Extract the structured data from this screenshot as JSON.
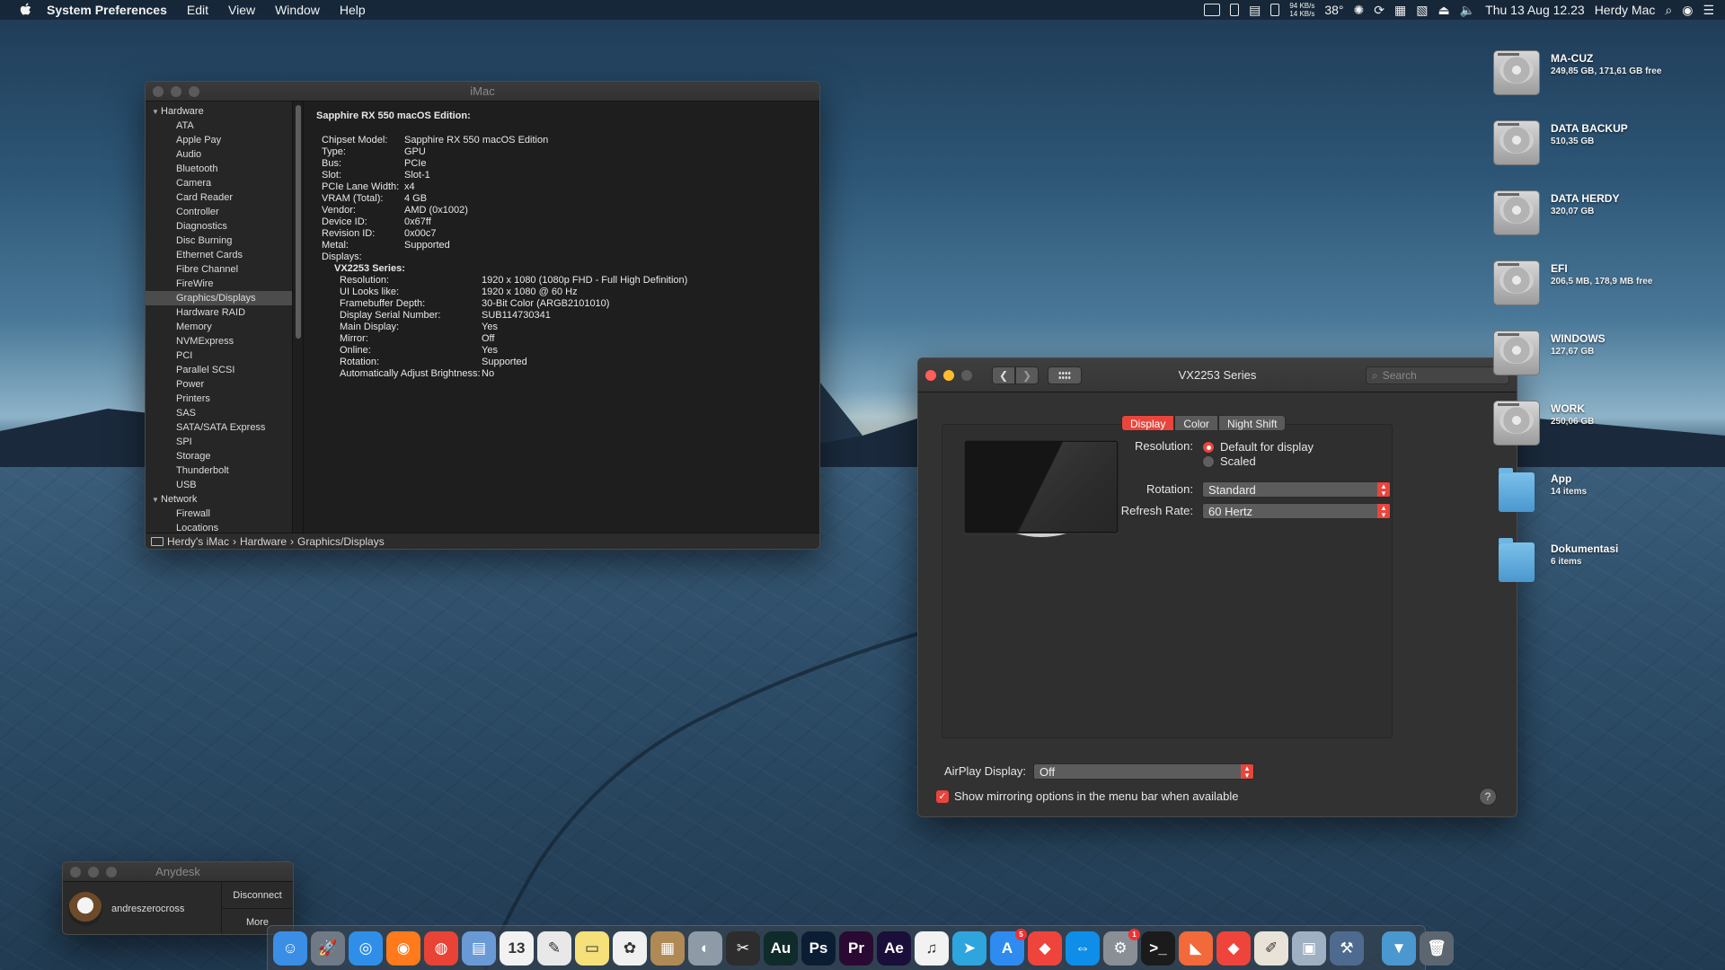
{
  "menubar": {
    "app_name": "System Preferences",
    "menus": [
      "Edit",
      "View",
      "Window",
      "Help"
    ],
    "net_up": "94 KB/s",
    "net_down": "14 KB/s",
    "temperature": "38°",
    "datetime": "Thu 13 Aug  12.23",
    "user": "Herdy Mac"
  },
  "sysinfo": {
    "title": "iMac",
    "sidebar_groups": [
      {
        "label": "Hardware",
        "items": [
          "ATA",
          "Apple Pay",
          "Audio",
          "Bluetooth",
          "Camera",
          "Card Reader",
          "Controller",
          "Diagnostics",
          "Disc Burning",
          "Ethernet Cards",
          "Fibre Channel",
          "FireWire",
          "Graphics/Displays",
          "Hardware RAID",
          "Memory",
          "NVMExpress",
          "PCI",
          "Parallel SCSI",
          "Power",
          "Printers",
          "SAS",
          "SATA/SATA Express",
          "SPI",
          "Storage",
          "Thunderbolt",
          "USB"
        ]
      },
      {
        "label": "Network",
        "items": [
          "Firewall",
          "Locations"
        ]
      }
    ],
    "selected_item": "Graphics/Displays",
    "detail": {
      "heading": "Sapphire RX 550 macOS Edition:",
      "fields": [
        {
          "k": "Chipset Model:",
          "v": "Sapphire RX 550 macOS Edition"
        },
        {
          "k": "Type:",
          "v": "GPU"
        },
        {
          "k": "Bus:",
          "v": "PCIe"
        },
        {
          "k": "Slot:",
          "v": "Slot-1"
        },
        {
          "k": "PCIe Lane Width:",
          "v": "x4"
        },
        {
          "k": "VRAM (Total):",
          "v": "4 GB"
        },
        {
          "k": "Vendor:",
          "v": "AMD (0x1002)"
        },
        {
          "k": "Device ID:",
          "v": "0x67ff"
        },
        {
          "k": "Revision ID:",
          "v": "0x00c7"
        },
        {
          "k": "Metal:",
          "v": "Supported"
        },
        {
          "k": "Displays:",
          "v": ""
        }
      ],
      "display_name": "VX2253 Series:",
      "display_fields": [
        {
          "k": "Resolution:",
          "v": "1920 x 1080 (1080p FHD - Full High Definition)"
        },
        {
          "k": "UI Looks like:",
          "v": "1920 x 1080 @ 60 Hz"
        },
        {
          "k": "Framebuffer Depth:",
          "v": "30-Bit Color (ARGB2101010)"
        },
        {
          "k": "Display Serial Number:",
          "v": "SUB114730341"
        },
        {
          "k": "Main Display:",
          "v": "Yes"
        },
        {
          "k": "Mirror:",
          "v": "Off"
        },
        {
          "k": "Online:",
          "v": "Yes"
        },
        {
          "k": "Rotation:",
          "v": "Supported"
        },
        {
          "k": "Automatically Adjust Brightness:",
          "v": "No"
        }
      ]
    },
    "pathbar": [
      "Herdy's iMac",
      "Hardware",
      "Graphics/Displays"
    ]
  },
  "display_prefs": {
    "title": "VX2253 Series",
    "search_placeholder": "Search",
    "tabs": [
      "Display",
      "Color",
      "Night Shift"
    ],
    "active_tab": "Display",
    "resolution_label": "Resolution:",
    "resolution_options": [
      "Default for display",
      "Scaled"
    ],
    "resolution_selected": "Default for display",
    "rotation_label": "Rotation:",
    "rotation_value": "Standard",
    "refresh_label": "Refresh Rate:",
    "refresh_value": "60 Hertz",
    "airplay_label": "AirPlay Display:",
    "airplay_value": "Off",
    "mirroring_label": "Show mirroring options in the menu bar when available",
    "mirroring_checked": true,
    "help": "?"
  },
  "anydesk": {
    "title": "Anydesk",
    "user": "andreszerocross",
    "disconnect": "Disconnect",
    "more": "More"
  },
  "drives": [
    {
      "name": "MA-CUZ",
      "info": "249,85 GB, 171,61 GB free",
      "kind": "hdd"
    },
    {
      "name": "DATA BACKUP",
      "info": "510,35 GB",
      "kind": "hdd"
    },
    {
      "name": "DATA HERDY",
      "info": "320,07 GB",
      "kind": "hdd"
    },
    {
      "name": "EFI",
      "info": "206,5 MB, 178,9 MB free",
      "kind": "hdd"
    },
    {
      "name": "WINDOWS",
      "info": "127,67 GB",
      "kind": "hdd"
    },
    {
      "name": "WORK",
      "info": "250,06 GB",
      "kind": "hdd"
    },
    {
      "name": "App",
      "info": "14 items",
      "kind": "folder"
    },
    {
      "name": "Dokumentasi",
      "info": "6 items",
      "kind": "folder"
    }
  ],
  "dock": {
    "items": [
      {
        "name": "finder",
        "glyph": "☺",
        "color": "#3a8ee6"
      },
      {
        "name": "launchpad",
        "glyph": "🚀",
        "color": "#6f7a86"
      },
      {
        "name": "safari",
        "glyph": "◎",
        "color": "#2f8fe8"
      },
      {
        "name": "firefox",
        "glyph": "◉",
        "color": "#ff7a1a"
      },
      {
        "name": "chrome",
        "glyph": "◍",
        "color": "#e94335"
      },
      {
        "name": "preview",
        "glyph": "▤",
        "color": "#6a9ad6"
      },
      {
        "name": "calendar",
        "glyph": "13",
        "color": "#f2f2f2"
      },
      {
        "name": "textedit",
        "glyph": "✎",
        "color": "#e8e8e8"
      },
      {
        "name": "notes",
        "glyph": "▭",
        "color": "#f5e07a"
      },
      {
        "name": "photos",
        "glyph": "✿",
        "color": "#f0f0f0"
      },
      {
        "name": "archive-utility",
        "glyph": "▦",
        "color": "#b08a55"
      },
      {
        "name": "disk-utility",
        "glyph": "◐",
        "color": "#8e9aa6"
      },
      {
        "name": "final-cut",
        "glyph": "✂",
        "color": "#2d2d2d"
      },
      {
        "name": "audition",
        "glyph": "Au",
        "color": "#0f2b2a"
      },
      {
        "name": "photoshop",
        "glyph": "Ps",
        "color": "#0b1d33"
      },
      {
        "name": "premiere",
        "glyph": "Pr",
        "color": "#2a0a33"
      },
      {
        "name": "after-effects",
        "glyph": "Ae",
        "color": "#1a0e3a"
      },
      {
        "name": "itunes",
        "glyph": "♫",
        "color": "#f2f2f2"
      },
      {
        "name": "telegram",
        "glyph": "➤",
        "color": "#2ea5dd"
      },
      {
        "name": "app-store",
        "glyph": "A",
        "color": "#2e8cf0",
        "badge": "5"
      },
      {
        "name": "anydesk",
        "glyph": "◆",
        "color": "#ef443b"
      },
      {
        "name": "teamviewer",
        "glyph": "⇔",
        "color": "#0e8ee9"
      },
      {
        "name": "system-preferences",
        "glyph": "⚙",
        "color": "#8a8f96",
        "badge": "1"
      },
      {
        "name": "terminal",
        "glyph": ">_",
        "color": "#1b1b1b"
      },
      {
        "name": "swift",
        "glyph": "◣",
        "color": "#f2693a"
      },
      {
        "name": "anydesk-2",
        "glyph": "◆",
        "color": "#ef443b"
      },
      {
        "name": "script-editor",
        "glyph": "✐",
        "color": "#e8e3d6"
      },
      {
        "name": "image-capture",
        "glyph": "▣",
        "color": "#9fb0c2"
      },
      {
        "name": "xcode",
        "glyph": "⚒",
        "color": "#4e6b8f"
      },
      {
        "name": "downloads-folder",
        "glyph": "▼",
        "color": "#4a98cf"
      },
      {
        "name": "trash",
        "glyph": "🗑",
        "color": "#5c6670"
      }
    ]
  }
}
